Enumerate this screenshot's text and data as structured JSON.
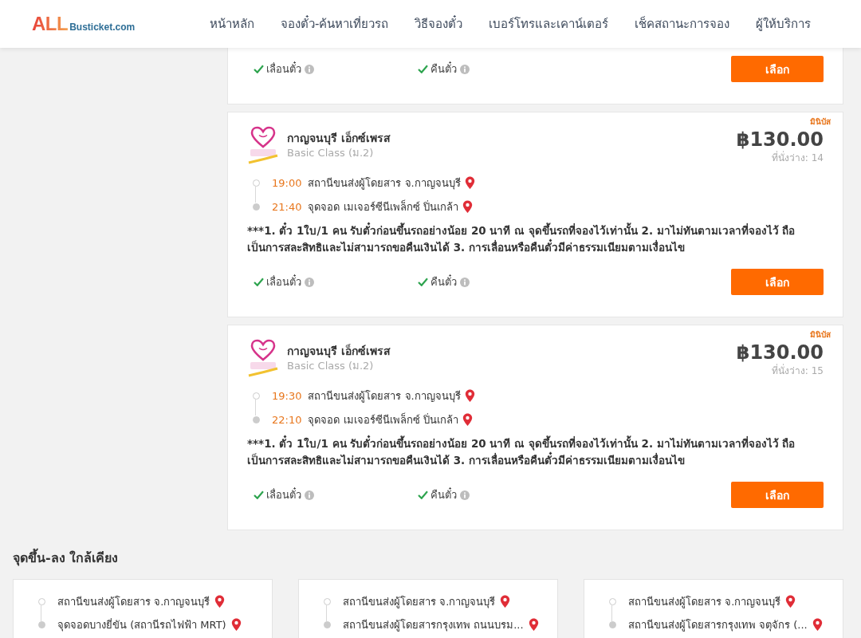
{
  "header": {
    "logo": {
      "brand": "ALL",
      "domain": "Busticket.com"
    },
    "nav": [
      {
        "label": "หน้าหลัก"
      },
      {
        "label": "จองตั๋ว-ค้นหาเที่ยวรถ"
      },
      {
        "label": "วิธีจองตั๋ว"
      },
      {
        "label": "เบอร์โทรและเคาน์เตอร์"
      },
      {
        "label": "เช็คสถานะการจอง"
      },
      {
        "label": "ผู้ให้บริการ"
      }
    ]
  },
  "trips": [
    {
      "features": [
        {
          "label": "เลื่อนตั๋ว",
          "available": true
        },
        {
          "label": "คืนตั๋ว",
          "available": true
        }
      ],
      "button": "เลือก"
    },
    {
      "vehicle": "มินิบัส",
      "operator": "กาญจนบุรี เอ็กซ์เพรส",
      "class": "Basic Class (ม.2)",
      "price": "฿130.00",
      "seats": "ที่นั่งว่าง: 14",
      "stops": [
        {
          "time": "19:00",
          "place": "สถานีขนส่งผู้โดยสาร จ.กาญจนบุรี"
        },
        {
          "time": "21:40",
          "place": "จุดจอด เมเจอร์ซีนีเพล็กซ์ ปิ่นเกล้า"
        }
      ],
      "note": "***1. ตั๋ว 1ใบ/1 คน รับตั๋วก่อนขึ้นรถอย่างน้อย 20 นาที ณ จุดขึ้นรถที่จองไว้เท่านั้น 2. มาไม่ทันตามเวลาที่จองไว้ ถือเป็นการสละสิทธิและไม่สามารถขอคืนเงินได้ 3. การเลื่อนหรือคืนตั๋วมีค่าธรรมเนียมตามเงื่อนไข",
      "features": [
        {
          "label": "เลื่อนตั๋ว",
          "available": true
        },
        {
          "label": "คืนตั๋ว",
          "available": true
        }
      ],
      "button": "เลือก"
    },
    {
      "vehicle": "มินิบัส",
      "operator": "กาญจนบุรี เอ็กซ์เพรส",
      "class": "Basic Class (ม.2)",
      "price": "฿130.00",
      "seats": "ที่นั่งว่าง: 15",
      "stops": [
        {
          "time": "19:30",
          "place": "สถานีขนส่งผู้โดยสาร จ.กาญจนบุรี"
        },
        {
          "time": "22:10",
          "place": "จุดจอด เมเจอร์ซีนีเพล็กซ์ ปิ่นเกล้า"
        }
      ],
      "note": "***1. ตั๋ว 1ใบ/1 คน รับตั๋วก่อนขึ้นรถอย่างน้อย 20 นาที ณ จุดขึ้นรถที่จองไว้เท่านั้น 2. มาไม่ทันตามเวลาที่จองไว้ ถือเป็นการสละสิทธิและไม่สามารถขอคืนเงินได้ 3. การเลื่อนหรือคืนตั๋วมีค่าธรรมเนียมตามเงื่อนไข",
      "features": [
        {
          "label": "เลื่อนตั๋ว",
          "available": true
        },
        {
          "label": "คืนตั๋ว",
          "available": true
        }
      ],
      "button": "เลือก"
    }
  ],
  "nearby": {
    "title": "จุดขึ้น-ลง ใกล้เคียง",
    "routes": [
      {
        "stops": [
          {
            "place": "สถานีขนส่งผู้โดยสาร จ.กาญจนบุรี"
          },
          {
            "place": "จุดจอดบางยี่ขัน (สถานีรถไฟฟ้า MRT)"
          }
        ]
      },
      {
        "stops": [
          {
            "place": "สถานีขนส่งผู้โดยสาร จ.กาญจนบุรี"
          },
          {
            "place": "สถานีขนส่งผู้โดยสารกรุงเทพ ถนนบรม..."
          }
        ]
      },
      {
        "stops": [
          {
            "place": "สถานีขนส่งผู้โดยสาร จ.กาญจนบุรี"
          },
          {
            "place": "สถานีขนส่งผู้โดยสารกรุงเทพ จตุจักร (..."
          }
        ]
      }
    ]
  }
}
